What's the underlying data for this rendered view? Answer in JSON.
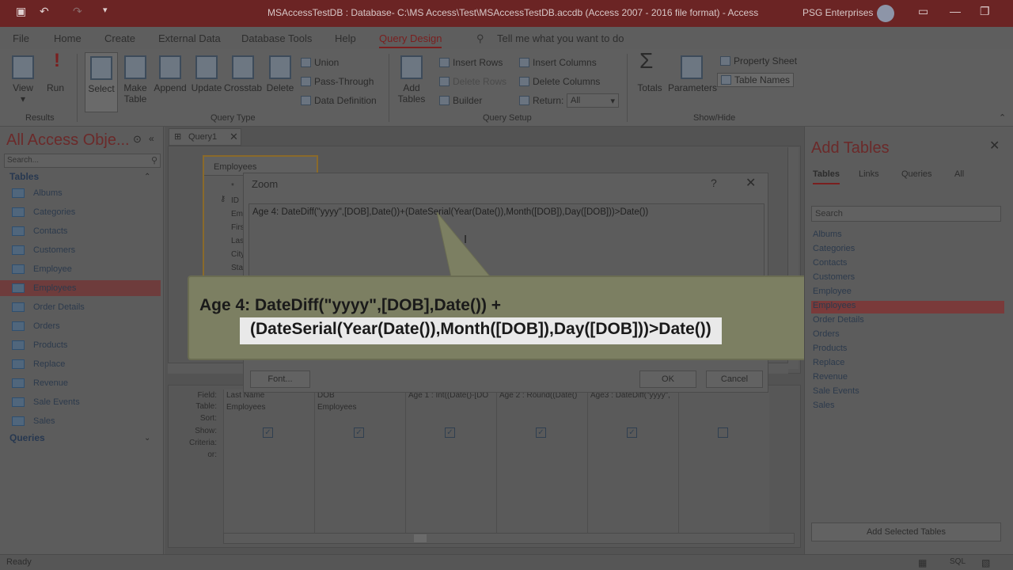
{
  "titlebar": {
    "title": "MSAccessTestDB : Database- C:\\MS Access\\Test\\MSAccessTestDB.accdb (Access 2007 - 2016 file format)  -  Access",
    "user": "PSG Enterprises"
  },
  "ribbon_tabs": [
    "File",
    "Home",
    "Create",
    "External Data",
    "Database Tools",
    "Help",
    "Query Design"
  ],
  "tell_me": "Tell me what you want to do",
  "ribbon": {
    "results": {
      "label": "Results",
      "view": "View",
      "run": "Run"
    },
    "query_type": {
      "label": "Query Type",
      "select": "Select",
      "make_table_1": "Make",
      "make_table_2": "Table",
      "append": "Append",
      "update": "Update",
      "crosstab": "Crosstab",
      "delete": "Delete",
      "union": "Union",
      "pass_through": "Pass-Through",
      "data_definition": "Data Definition"
    },
    "query_setup": {
      "label": "Query Setup",
      "add_tables_1": "Add",
      "add_tables_2": "Tables",
      "insert_rows": "Insert Rows",
      "delete_rows": "Delete Rows",
      "builder": "Builder",
      "insert_columns": "Insert Columns",
      "delete_columns": "Delete Columns",
      "return_label": "Return:",
      "return_value": "All"
    },
    "show_hide": {
      "label": "Show/Hide",
      "totals": "Totals",
      "parameters": "Parameters",
      "property_sheet": "Property Sheet",
      "table_names": "Table Names"
    }
  },
  "nav": {
    "title": "All Access Obje...",
    "search_placeholder": "Search...",
    "tables_header": "Tables",
    "tables": [
      "Albums",
      "Categories",
      "Contacts",
      "Customers",
      "Employee",
      "Employees",
      "Order Details",
      "Orders",
      "Products",
      "Replace",
      "Revenue",
      "Sale Events",
      "Sales"
    ],
    "selected": "Employees",
    "queries_header": "Queries"
  },
  "doc_tab": "Query1",
  "employees_table": {
    "title": "Employees",
    "fields": [
      "*",
      "ID",
      "Em",
      "Firs",
      "Las",
      "City",
      "Sta"
    ]
  },
  "zoom": {
    "title": "Zoom",
    "help": "?",
    "close": "✕",
    "text": "Age 4: DateDiff(\"yyyy\",[DOB],Date())+(DateSerial(Year(Date()),Month([DOB]),Day([DOB]))>Date())",
    "font_button": "Font...",
    "ok_button": "OK",
    "cancel_button": "Cancel"
  },
  "callout": {
    "line1": "Age 4: DateDiff(\"yyyy\",[DOB],Date()) +",
    "line2": "(DateSerial(Year(Date()),Month([DOB]),Day([DOB]))>Date())"
  },
  "grid": {
    "row_labels": [
      "Field:",
      "Table:",
      "Sort:",
      "Show:",
      "Criteria:",
      "or:"
    ],
    "columns": [
      {
        "field": "Last Name",
        "table": "Employees",
        "show": true
      },
      {
        "field": "DOB",
        "table": "Employees",
        "show": true
      },
      {
        "field": "Age 1 : Int((Date()-[DO",
        "table": "",
        "show": true
      },
      {
        "field": "Age 2 : Round((Date()",
        "table": "",
        "show": true
      },
      {
        "field": "Age3 : DateDiff(\"yyyy\",",
        "table": "",
        "show": true
      },
      {
        "field": "",
        "table": "",
        "show": false
      }
    ]
  },
  "add_tables": {
    "title": "Add Tables",
    "tabs": [
      "Tables",
      "Links",
      "Queries",
      "All"
    ],
    "search_placeholder": "Search",
    "items": [
      "Albums",
      "Categories",
      "Contacts",
      "Customers",
      "Employee",
      "Employees",
      "Order Details",
      "Orders",
      "Products",
      "Replace",
      "Revenue",
      "Sale Events",
      "Sales"
    ],
    "selected": "Employees",
    "add_button": "Add Selected Tables"
  },
  "status": {
    "text": "Ready",
    "sql": "SQL"
  }
}
